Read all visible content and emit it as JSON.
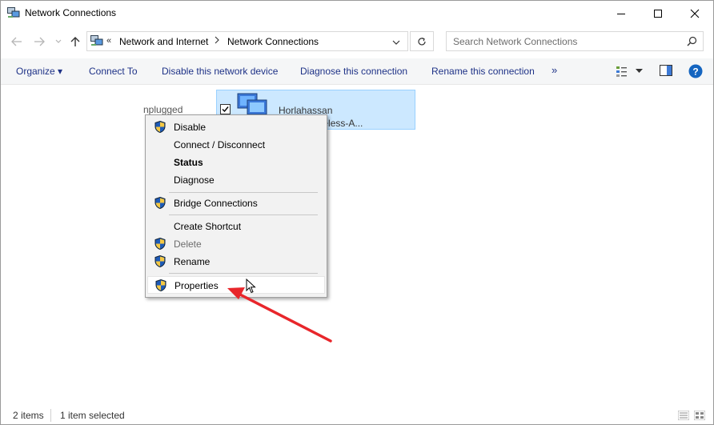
{
  "window": {
    "title": "Network Connections",
    "icon": "network-connections-icon"
  },
  "address": {
    "overflow": "«",
    "crumbs": [
      "Network and Internet",
      "Network Connections"
    ],
    "search_placeholder": "Search Network Connections"
  },
  "toolbar": {
    "organize": "Organize ▾",
    "connect_to": "Connect To",
    "disable": "Disable this network device",
    "diagnose": "Diagnose this connection",
    "rename": "Rename this connection",
    "more": "»"
  },
  "items": {
    "first_label": "nplugged",
    "selected": {
      "name": "Horlahassan",
      "device": "l Band Wireless-A..."
    }
  },
  "context_menu": {
    "disable": "Disable",
    "connect_disconnect": "Connect / Disconnect",
    "status": "Status",
    "diagnose": "Diagnose",
    "bridge": "Bridge Connections",
    "create_shortcut": "Create Shortcut",
    "delete": "Delete",
    "rename": "Rename",
    "properties": "Properties"
  },
  "status": {
    "items": "2 items",
    "selected": "1 item selected"
  },
  "colors": {
    "accent": "#1e3287",
    "selection": "#cce8ff",
    "arrow": "#e8262b",
    "help": "#1565c0"
  }
}
